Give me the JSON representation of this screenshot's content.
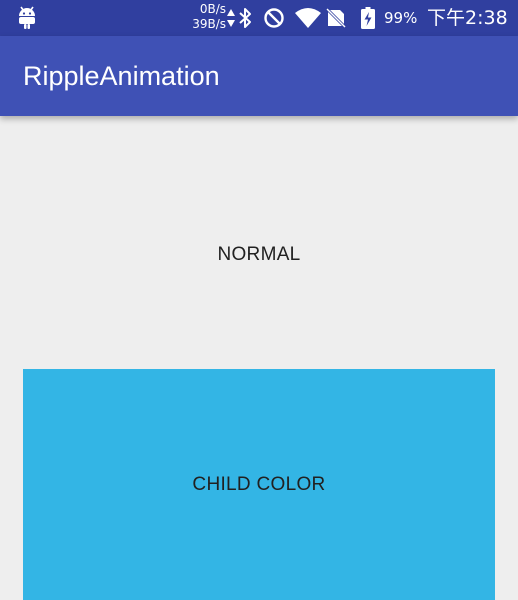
{
  "status_bar": {
    "net_speed_up": "0B/s",
    "net_speed_down": "39B/s",
    "battery": "99%",
    "time": "下午2:38",
    "icons": [
      "android-icon",
      "bluetooth-icon",
      "do-not-disturb-icon",
      "wifi-icon",
      "no-signal-icon",
      "battery-charging-icon"
    ]
  },
  "app_bar": {
    "title": "RippleAnimation",
    "color": "#3f51b5"
  },
  "buttons": {
    "normal_label": "NORMAL",
    "child_color_label": "CHILD COLOR",
    "child_color_bg": "#33b5e5"
  },
  "colors": {
    "status_bar": "#303f9f",
    "background": "#eeeeee"
  }
}
